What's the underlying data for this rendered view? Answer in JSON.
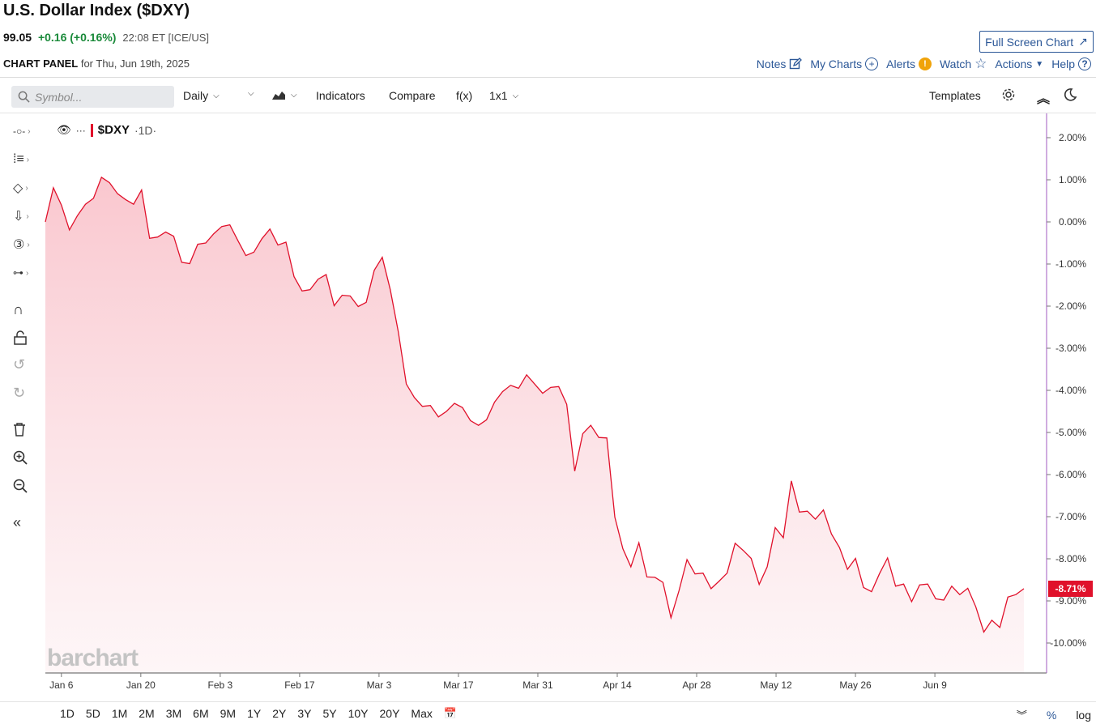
{
  "header": {
    "title": "U.S. Dollar Index ($DXY)",
    "price": "99.05",
    "change": "+0.16 (+0.16%)",
    "time": "22:08 ET [ICE/US]",
    "fullscreen_label": "Full Screen Chart",
    "panel_label": "CHART PANEL",
    "panel_date": "for Thu, Jun 19th, 2025"
  },
  "toplinks": {
    "notes": "Notes",
    "my_charts": "My Charts",
    "alerts": "Alerts",
    "watch": "Watch",
    "actions": "Actions",
    "help": "Help"
  },
  "toolbar": {
    "search_placeholder": "Symbol...",
    "interval": "Daily",
    "indicators": "Indicators",
    "compare": "Compare",
    "fx": "f(x)",
    "layout": "1x1",
    "templates": "Templates"
  },
  "legend": {
    "symbol": "$DXY",
    "interval": "·1D·"
  },
  "watermark": "barchart",
  "colors": {
    "line": "#e0112b",
    "fill_top": "#f9c9d0",
    "link": "#2b5797",
    "positive": "#1a8a3a"
  },
  "range_buttons": [
    "1D",
    "5D",
    "1M",
    "2M",
    "3M",
    "6M",
    "9M",
    "1Y",
    "2Y",
    "3Y",
    "5Y",
    "10Y",
    "20Y",
    "Max"
  ],
  "bottom_right": {
    "percent": "%",
    "log": "log"
  },
  "chart_data": {
    "type": "area",
    "series": [
      {
        "name": "$DXY",
        "values": [
          0.0,
          0.81,
          0.4,
          -0.19,
          0.15,
          0.42,
          0.56,
          1.06,
          0.93,
          0.67,
          0.53,
          0.42,
          0.76,
          -0.39,
          -0.36,
          -0.24,
          -0.34,
          -0.96,
          -0.99,
          -0.53,
          -0.5,
          -0.28,
          -0.11,
          -0.07,
          -0.44,
          -0.8,
          -0.72,
          -0.4,
          -0.17,
          -0.55,
          -0.48,
          -1.3,
          -1.64,
          -1.61,
          -1.36,
          -1.25,
          -1.99,
          -1.74,
          -1.76,
          -2.01,
          -1.91,
          -1.15,
          -0.84,
          -1.61,
          -2.61,
          -3.85,
          -4.17,
          -4.38,
          -4.36,
          -4.63,
          -4.5,
          -4.31,
          -4.41,
          -4.72,
          -4.83,
          -4.7,
          -4.28,
          -4.03,
          -3.88,
          -3.95,
          -3.63,
          -3.85,
          -4.07,
          -3.93,
          -3.91,
          -4.33,
          -5.92,
          -5.03,
          -4.83,
          -5.12,
          -5.13,
          -7.01,
          -7.76,
          -8.19,
          -7.62,
          -8.43,
          -8.44,
          -8.56,
          -9.4,
          -8.76,
          -8.02,
          -8.36,
          -8.34,
          -8.71,
          -8.53,
          -8.34,
          -7.63,
          -7.8,
          -7.99,
          -8.61,
          -8.19,
          -7.26,
          -7.5,
          -6.15,
          -6.89,
          -6.87,
          -7.06,
          -6.84,
          -7.41,
          -7.73,
          -8.25,
          -7.99,
          -8.68,
          -8.78,
          -8.35,
          -7.98,
          -8.65,
          -8.6,
          -9.02,
          -8.62,
          -8.6,
          -8.95,
          -8.98,
          -8.65,
          -8.85,
          -8.7,
          -9.14,
          -9.74,
          -9.46,
          -9.63,
          -8.91,
          -8.85,
          -8.71
        ]
      }
    ],
    "x_tick_labels": [
      "Jan 6",
      "Jan 20",
      "Feb 3",
      "Feb 17",
      "Mar 3",
      "Mar 17",
      "Mar 31",
      "Apr 14",
      "Apr 28",
      "May 12",
      "May 26",
      "Jun 9"
    ],
    "y_tick_labels": [
      "2.00%",
      "1.00%",
      "0.00%",
      "-1.00%",
      "-2.00%",
      "-3.00%",
      "-4.00%",
      "-5.00%",
      "-6.00%",
      "-7.00%",
      "-8.00%",
      "-9.00%",
      "-10.00%"
    ],
    "ylim": [
      -10.5,
      2.3
    ],
    "last_value_label": "-8.71%",
    "grid": false
  }
}
